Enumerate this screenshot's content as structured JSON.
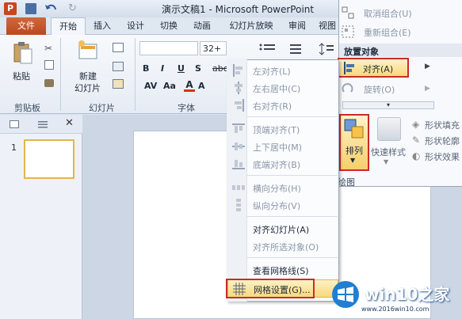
{
  "window": {
    "title": "演示文稿1 - Microsoft PowerPoint"
  },
  "tabs": [
    {
      "label": "文件"
    },
    {
      "label": "开始"
    },
    {
      "label": "插入"
    },
    {
      "label": "设计"
    },
    {
      "label": "切换"
    },
    {
      "label": "动画"
    },
    {
      "label": "幻灯片放映"
    },
    {
      "label": "审阅"
    },
    {
      "label": "视图"
    }
  ],
  "ribbon": {
    "paste": "粘贴",
    "new_slide_line1": "新建",
    "new_slide_line2": "幻灯片",
    "font_size": "32+",
    "groups": {
      "clipboard": "剪贴板",
      "slides": "幻灯片",
      "font": "字体"
    }
  },
  "align_menu": {
    "items": [
      {
        "label": "左对齐(L)",
        "enabled": false,
        "icon": "align-left-icon"
      },
      {
        "label": "左右居中(C)",
        "enabled": false,
        "icon": "align-center-icon"
      },
      {
        "label": "右对齐(R)",
        "enabled": false,
        "icon": "align-right-icon"
      },
      {
        "label": "顶端对齐(T)",
        "enabled": false,
        "icon": "align-top-icon"
      },
      {
        "label": "上下居中(M)",
        "enabled": false,
        "icon": "align-middle-icon"
      },
      {
        "label": "底端对齐(B)",
        "enabled": false,
        "icon": "align-bottom-icon"
      },
      {
        "label": "横向分布(H)",
        "enabled": false,
        "icon": "distribute-horizontal-icon"
      },
      {
        "label": "纵向分布(V)",
        "enabled": false,
        "icon": "distribute-vertical-icon"
      },
      {
        "label": "对齐幻灯片(A)",
        "enabled": true
      },
      {
        "label": "对齐所选对象(O)",
        "enabled": false
      },
      {
        "label": "查看网格线(S)",
        "enabled": true
      },
      {
        "label": "网格设置(G)...",
        "enabled": true,
        "icon": "grid-icon"
      }
    ]
  },
  "arrange_panel": {
    "ungroup": "取消组合(U)",
    "regroup": "重新组合(E)",
    "section_title": "放置对象",
    "align": "对齐(A)",
    "rotate": "旋转(O)",
    "arrange_button": "排列",
    "quick_styles": "快速样式",
    "shape_fill": "形状填充",
    "shape_outline": "形状轮廓",
    "shape_effects": "形状效果",
    "drawing_group": "绘图"
  },
  "slides_panel": {
    "slide_number": "1"
  },
  "watermark": {
    "brand": "win10之家",
    "url": "www.2016win10.com"
  },
  "colors": {
    "accent_orange": "#c95a2c",
    "highlight_red": "#cc2a2a",
    "hover_gold": "#f7d97c"
  }
}
